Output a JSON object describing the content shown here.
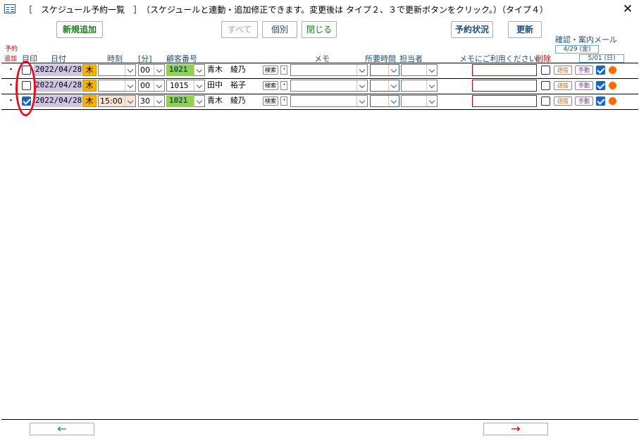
{
  "window": {
    "title": "［　スケジュール予約一覧　］　（スケジュールと連動・追加修正できます。変更後は タイプ２、３で更新ボタンをクリック。）（タイプ４）"
  },
  "toolbar": {
    "add_label": "新規追加",
    "all_label": "すべて",
    "individual_label": "個別",
    "close_label": "閉じる",
    "status_label": "予約状況",
    "update_label": "更新"
  },
  "headers": {
    "add_reserve_1": "予約",
    "add_reserve_2": "追加",
    "mark": "目印",
    "date": "日付",
    "time": "時刻",
    "minute": "[分]",
    "customer_no": "顧客番号",
    "memo": "メモ",
    "duration": "所要時間",
    "staff": "担当者",
    "memo_usage": "メモにご利用ください。",
    "delete": "削除",
    "confirm_mail": "確認・案内メール",
    "date_a": "4/29 (金)",
    "date_b": "5/01 (日)"
  },
  "rows": [
    {
      "dot": "・",
      "mark_checked": false,
      "date": "2022/04/28",
      "weekday": "木",
      "hour": "",
      "minute": "00",
      "cust_no": "1021",
      "name": "青木　綾乃",
      "search": "検索",
      "small_dot": "・",
      "send": "送信",
      "manual": "手動",
      "mail_checked": true
    },
    {
      "dot": "・",
      "mark_checked": false,
      "date": "2022/04/28",
      "weekday": "木",
      "hour": "",
      "minute": "00",
      "cust_no": "1015",
      "name": "田中　裕子",
      "search": "検索",
      "small_dot": "・",
      "send": "送信",
      "manual": "手動",
      "mail_checked": true
    },
    {
      "dot": "・",
      "mark_checked": true,
      "date": "2022/04/28",
      "weekday": "木",
      "hour": "15:00",
      "minute": "30",
      "cust_no": "1021",
      "name": "青木　綾乃",
      "search": "検索",
      "small_dot": "・",
      "send": "送信",
      "manual": "手動",
      "mail_checked": true
    }
  ],
  "footer": {
    "prev_arrow": "←",
    "next_arrow": "→"
  },
  "colors": {
    "accent_green": "#217a21",
    "accent_blue": "#1f4e79",
    "date_bg": "#cfc4e4",
    "weekday_bg": "#f7b500",
    "customer_bg": "#92d050",
    "orange_dot": "#ff6a00",
    "annotation_red": "#e01020"
  }
}
